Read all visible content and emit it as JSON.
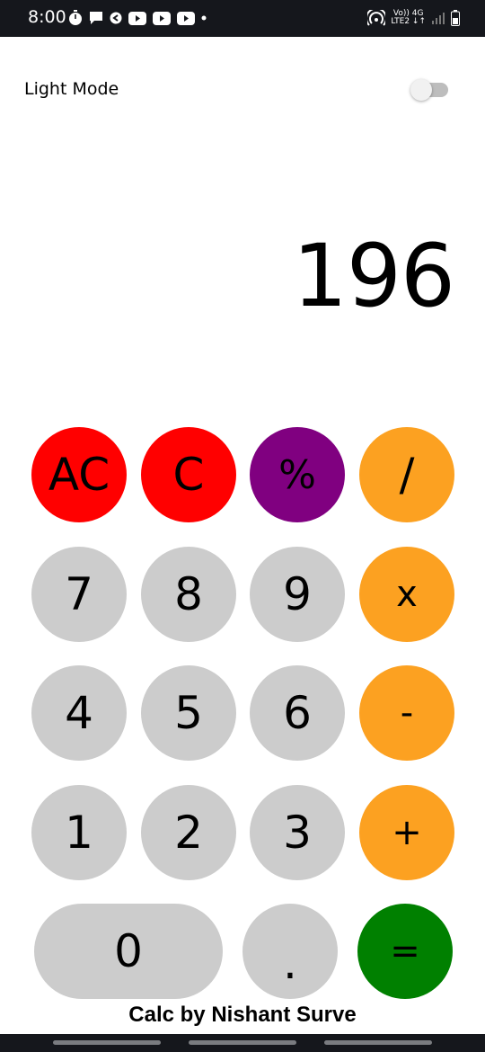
{
  "status_bar": {
    "time": "8:00",
    "left_icons": [
      "timer-icon",
      "chat-icon",
      "app-icon",
      "youtube-icon",
      "youtube-icon",
      "youtube-icon",
      "dot-icon"
    ],
    "network_top": "Vo)) 4G",
    "network_bottom": "LTE2 ↓↑",
    "right_icons": [
      "hotspot-icon",
      "signal-icon",
      "battery-icon"
    ]
  },
  "settings": {
    "mode_label": "Light Mode",
    "toggle_on": false
  },
  "display": {
    "value": "196"
  },
  "keypad": {
    "row1": [
      "AC",
      "C",
      "%",
      "/"
    ],
    "row2": [
      "7",
      "8",
      "9",
      "x"
    ],
    "row3": [
      "4",
      "5",
      "6",
      "-"
    ],
    "row4": [
      "1",
      "2",
      "3",
      "+"
    ],
    "row5": [
      "0",
      ".",
      "="
    ]
  },
  "colors": {
    "clear": "#ff0000",
    "percent": "#800080",
    "operator": "#fca121",
    "digit": "#cccccc",
    "equals": "#008000"
  },
  "footer": {
    "credit": "Calc by Nishant Surve"
  }
}
